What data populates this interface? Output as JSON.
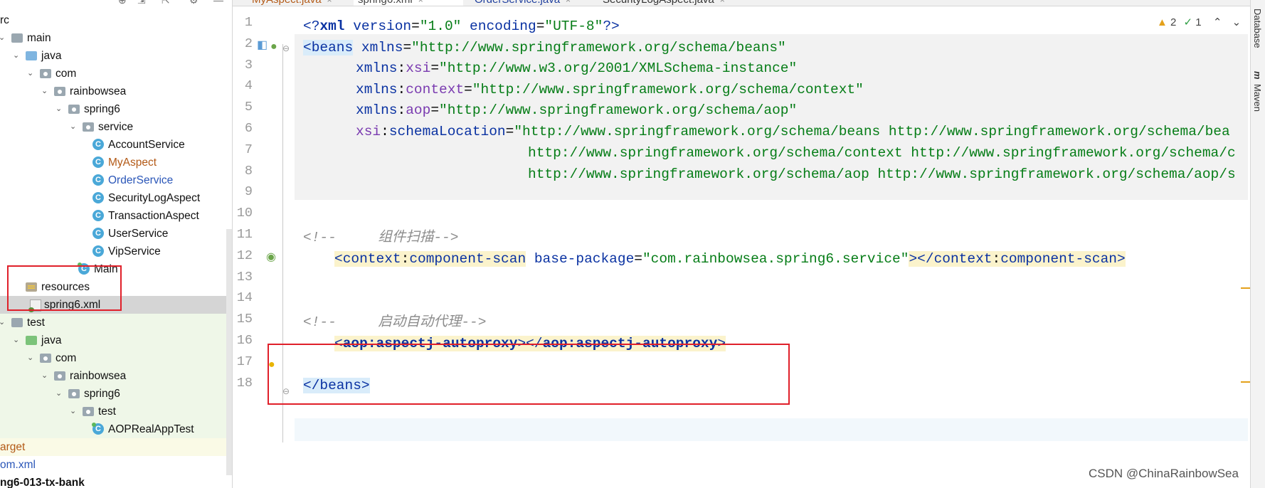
{
  "tabs": [
    {
      "label": "MyAspect.java",
      "state": "modified"
    },
    {
      "label": "spring6.xml",
      "state": "active"
    },
    {
      "label": "OrderService.java",
      "state": "normal"
    },
    {
      "label": "SecurityLogAspect.java",
      "state": "normal"
    }
  ],
  "tree": [
    {
      "label": "rc",
      "indent": 0,
      "kind": "text"
    },
    {
      "label": "main",
      "indent": 0,
      "kind": "folder"
    },
    {
      "label": "java",
      "indent": 1,
      "kind": "folder-blue"
    },
    {
      "label": "com",
      "indent": 2,
      "kind": "package"
    },
    {
      "label": "rainbowsea",
      "indent": 3,
      "kind": "package"
    },
    {
      "label": "spring6",
      "indent": 4,
      "kind": "package"
    },
    {
      "label": "service",
      "indent": 5,
      "kind": "package"
    },
    {
      "label": "AccountService",
      "indent": 6,
      "kind": "class"
    },
    {
      "label": "MyAspect",
      "indent": 6,
      "kind": "class",
      "color": "orange"
    },
    {
      "label": "OrderService",
      "indent": 6,
      "kind": "class",
      "color": "blue"
    },
    {
      "label": "SecurityLogAspect",
      "indent": 6,
      "kind": "class"
    },
    {
      "label": "TransactionAspect",
      "indent": 6,
      "kind": "class"
    },
    {
      "label": "UserService",
      "indent": 6,
      "kind": "class"
    },
    {
      "label": "VipService",
      "indent": 6,
      "kind": "class"
    },
    {
      "label": "Main",
      "indent": 5,
      "kind": "main-class"
    },
    {
      "label": "resources",
      "indent": 1,
      "kind": "resources"
    },
    {
      "label": "spring6.xml",
      "indent": 2,
      "kind": "xml",
      "selected": true
    },
    {
      "label": "test",
      "indent": 0,
      "kind": "folder"
    },
    {
      "label": "java",
      "indent": 1,
      "kind": "folder-green"
    },
    {
      "label": "com",
      "indent": 2,
      "kind": "package"
    },
    {
      "label": "rainbowsea",
      "indent": 3,
      "kind": "package"
    },
    {
      "label": "spring6",
      "indent": 4,
      "kind": "package"
    },
    {
      "label": "test",
      "indent": 5,
      "kind": "package"
    },
    {
      "label": "AOPRealAppTest",
      "indent": 6,
      "kind": "main-class"
    },
    {
      "label": "arget",
      "indent": 0,
      "kind": "text",
      "color": "orange"
    },
    {
      "label": "om.xml",
      "indent": 0,
      "kind": "text",
      "color": "blue"
    },
    {
      "label": "ng6-013-tx-bank",
      "indent": 0,
      "kind": "text",
      "bold": true
    }
  ],
  "editor": {
    "line_numbers": [
      "1",
      "2",
      "3",
      "4",
      "5",
      "6",
      "7",
      "8",
      "9",
      "10",
      "11",
      "12",
      "13",
      "14",
      "15",
      "16",
      "17",
      "18"
    ],
    "inspections": {
      "warnings": "2",
      "ok": "1"
    },
    "lines": {
      "l1_pi_open": "<?",
      "l1_pi_name": "xml ",
      "l1_attr1": "version",
      "l1_val1": "\"1.0\"",
      "l1_attr2": " encoding",
      "l1_val2": "\"UTF-8\"",
      "l1_pi_close": "?>",
      "l2_tag": "<beans",
      "l2_attr": "xmlns",
      "l2_val": "\"http://www.springframework.org/schema/beans\"",
      "l3_ns": "xmlns",
      "l3_attr": "xsi",
      "l3_val": "\"http://www.w3.org/2001/XMLSchema-instance\"",
      "l4_ns": "xmlns",
      "l4_attr": "context",
      "l4_val": "\"http://www.springframework.org/schema/context\"",
      "l5_ns": "xmlns",
      "l5_attr": "aop",
      "l5_val": "\"http://www.springframework.org/schema/aop\"",
      "l6_ns": "xsi",
      "l6_attr": "schemaLocation",
      "l6_val": "\"http://www.springframework.org/schema/beans http://www.springframework.org/schema/bea",
      "l7_val": "http://www.springframework.org/schema/context http://www.springframework.org/schema/c",
      "l8_val": "http://www.springframework.org/schema/aop http://www.springframework.org/schema/aop/s",
      "l11_cmt": "<!--     组件扫描-->",
      "l12_tag_open": "<context",
      "l12_tag_name": "component-scan",
      "l12_attr": " base-package",
      "l12_val": "\"com.rainbowsea.spring6.service\"",
      "l12_close_a": "></",
      "l12_close_ns": "context",
      "l12_close_name": "component-scan",
      "l15_cmt": "<!--     启动自动代理-->",
      "l16_ns": "aop",
      "l16_name": "aspectj-autoproxy",
      "l18_tag": "</beans>"
    }
  },
  "right_tools": [
    "Database",
    "Maven"
  ],
  "watermark": "CSDN @ChinaRainbowSea"
}
